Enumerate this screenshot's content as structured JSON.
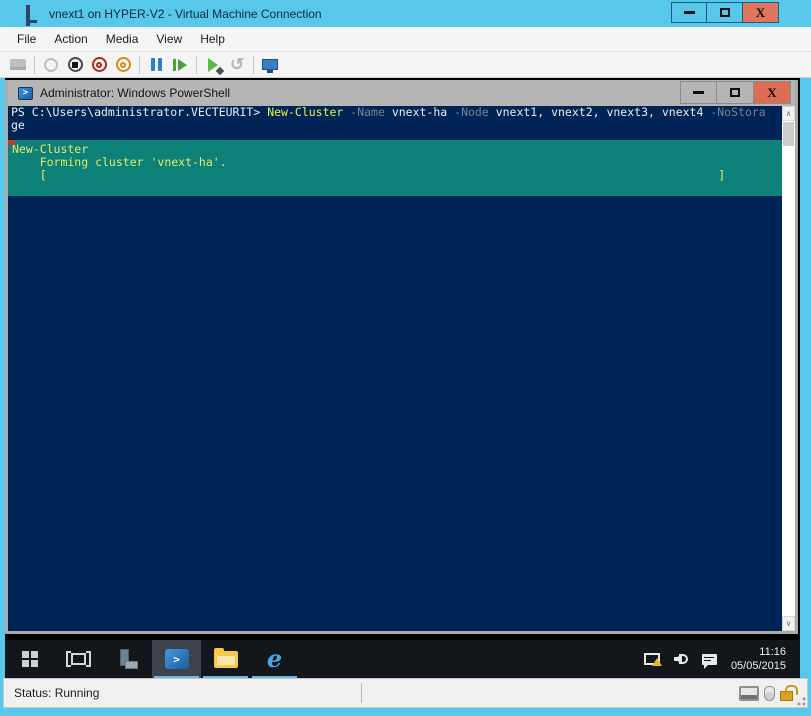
{
  "vm_window": {
    "title": "vnext1 on HYPER-V2 - Virtual Machine Connection",
    "menu": {
      "file": "File",
      "action": "Action",
      "media": "Media",
      "view": "View",
      "help": "Help"
    },
    "window_buttons": {
      "close": "X"
    },
    "toolbar_icons": [
      "ctrl-alt-delete",
      "start",
      "turn-off",
      "shut-down",
      "save",
      "pause",
      "reset",
      "checkpoint",
      "revert",
      "enhanced-session"
    ],
    "status_bar": {
      "status": "Status: Running"
    }
  },
  "powershell": {
    "title": "Administrator: Windows PowerShell",
    "title_icon_glyph": ">",
    "window_buttons": {
      "close": "X"
    },
    "prompt": "PS C:\\Users\\administrator.VECTEURIT> ",
    "command": {
      "cmdlet": "New-Cluster",
      "param_name": " -Name ",
      "arg_name": "vnext-ha",
      "param_node": " -Node ",
      "arg_nodes": "vnext1, vnext2, vnext3, vnext4",
      "param_nostorage": " -NoStora",
      "wrap": "ge"
    },
    "progress": {
      "activity": "New-Cluster",
      "status_line": "    Forming cluster 'vnext-ha'.",
      "bar_line": "    [                                                                                                 ]"
    },
    "scrollbar": {
      "up": "∧",
      "down": "∨"
    }
  },
  "taskbar": {
    "icons": [
      "start",
      "task-view",
      "server-manager",
      "powershell",
      "file-explorer",
      "internet-explorer"
    ],
    "powershell_glyph": ">",
    "ie_glyph": "e",
    "tray_icons": [
      "network-warning",
      "volume",
      "action-center"
    ],
    "clock": {
      "time": "11:16",
      "date": "05/05/2015"
    }
  },
  "colors": {
    "accent_cyan": "#57c8ea",
    "close_red": "#e0745e",
    "console_bg": "#012456",
    "progress_bg": "#0d8078",
    "progress_text": "#e2eb6e",
    "cmdlet_yellow": "#eded4e",
    "param_gray": "#78828f",
    "taskbar_bg": "#13161b",
    "running_indicator": "#6ab7e8"
  }
}
